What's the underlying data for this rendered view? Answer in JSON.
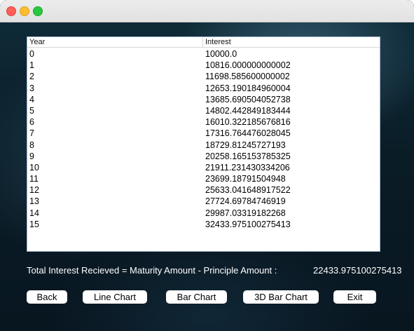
{
  "window": {
    "title": ""
  },
  "table": {
    "columns": [
      "Year",
      "Interest"
    ],
    "rows": [
      [
        "0",
        "10000.0"
      ],
      [
        "1",
        "10816.000000000002"
      ],
      [
        "2",
        "11698.585600000002"
      ],
      [
        "3",
        "12653.190184960004"
      ],
      [
        "4",
        "13685.690504052738"
      ],
      [
        "5",
        "14802.442849183444"
      ],
      [
        "6",
        "16010.322185676816"
      ],
      [
        "7",
        "17316.764476028045"
      ],
      [
        "8",
        "18729.81245727193"
      ],
      [
        "9",
        "20258.165153785325"
      ],
      [
        "10",
        "21911.231430334206"
      ],
      [
        "11",
        "23699.18791504948"
      ],
      [
        "12",
        "25633.041648917522"
      ],
      [
        "13",
        "27724.69784746919"
      ],
      [
        "14",
        "29987.03319182268"
      ],
      [
        "15",
        "32433.975100275413"
      ]
    ]
  },
  "summary": {
    "label": "Total Interest Recieved = Maturity Amount - Principle Amount :",
    "value": "22433.975100275413"
  },
  "buttons": {
    "back": "Back",
    "line_chart": "Line Chart",
    "bar_chart": "Bar Chart",
    "bar_chart_3d": "3D Bar Chart",
    "exit": "Exit"
  }
}
